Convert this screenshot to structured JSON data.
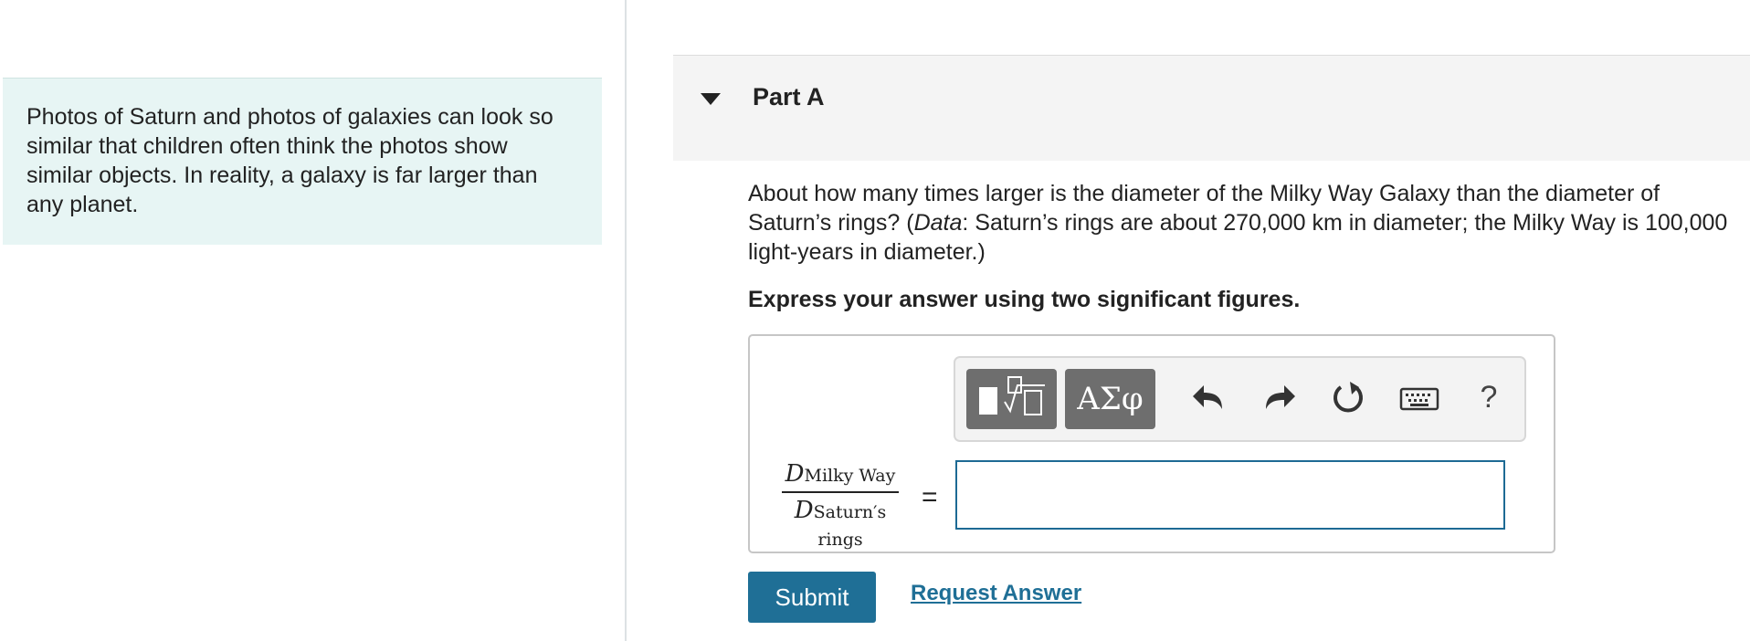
{
  "intro": {
    "text": "Photos of Saturn and photos of galaxies can look so similar that children often think the photos show similar objects. In reality, a galaxy is far larger than any planet."
  },
  "part": {
    "title": "Part A"
  },
  "question": {
    "prefix": "About how many times larger is the diameter of the Milky Way Galaxy than the diameter of Saturn’s rings? (",
    "data_label": "Data",
    "suffix": ": Saturn’s rings are about 270,000 km in diameter; the Milky Way is 100,000 light-years in diameter.)"
  },
  "instruction": "Express your answer using two significant figures.",
  "toolbar": {
    "symbols_label": "ΑΣφ",
    "help_label": "?"
  },
  "equation": {
    "var_num": "D",
    "sub_num": "Milky Way",
    "var_den": "D",
    "sub_den": "Saturn′s rings",
    "equals": "="
  },
  "answer": {
    "value": "",
    "placeholder": ""
  },
  "actions": {
    "submit_label": "Submit",
    "request_label": "Request Answer"
  }
}
